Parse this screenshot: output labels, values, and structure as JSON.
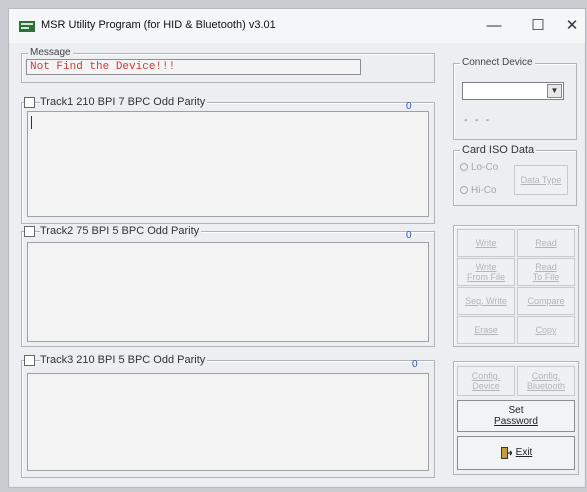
{
  "window": {
    "title": "MSR Utility Program (for HID & Bluetooth) v3.01",
    "minimize": "—",
    "maximize": "☐",
    "close": "✕"
  },
  "message": {
    "legend": "Message",
    "text": "Not Find the Device!!!"
  },
  "tracks": [
    {
      "label": "Track1   210 BPI 7 BPC Odd Parity",
      "count": "0"
    },
    {
      "label": "Track2   75 BPI 5 BPC Odd Parity",
      "count": "0"
    },
    {
      "label": "Track3   210 BPI 5 BPC Odd Parity",
      "count": "0"
    }
  ],
  "connect": {
    "legend": "Connect Device",
    "status": "- - -"
  },
  "card": {
    "legend": "Card ISO Data",
    "lo_co": "Lo-Co",
    "hi_co": "Hi-Co",
    "data_type": "Data Type"
  },
  "buttons": {
    "write": "Write",
    "read": "Read",
    "write_file_1": "Write",
    "write_file_2": "From File",
    "read_file_1": "Read",
    "read_file_2": "To File",
    "seq_write": "Seq. Write",
    "compare": "Compare",
    "erase": "Erase",
    "copy": "Copy",
    "config_device_1": "Config.",
    "config_device_2": "Device",
    "config_bt_1": "Config.",
    "config_bt_2": "Bluetooth",
    "set_password_1": "Set",
    "set_password_2": "Password",
    "exit": "Exit"
  }
}
